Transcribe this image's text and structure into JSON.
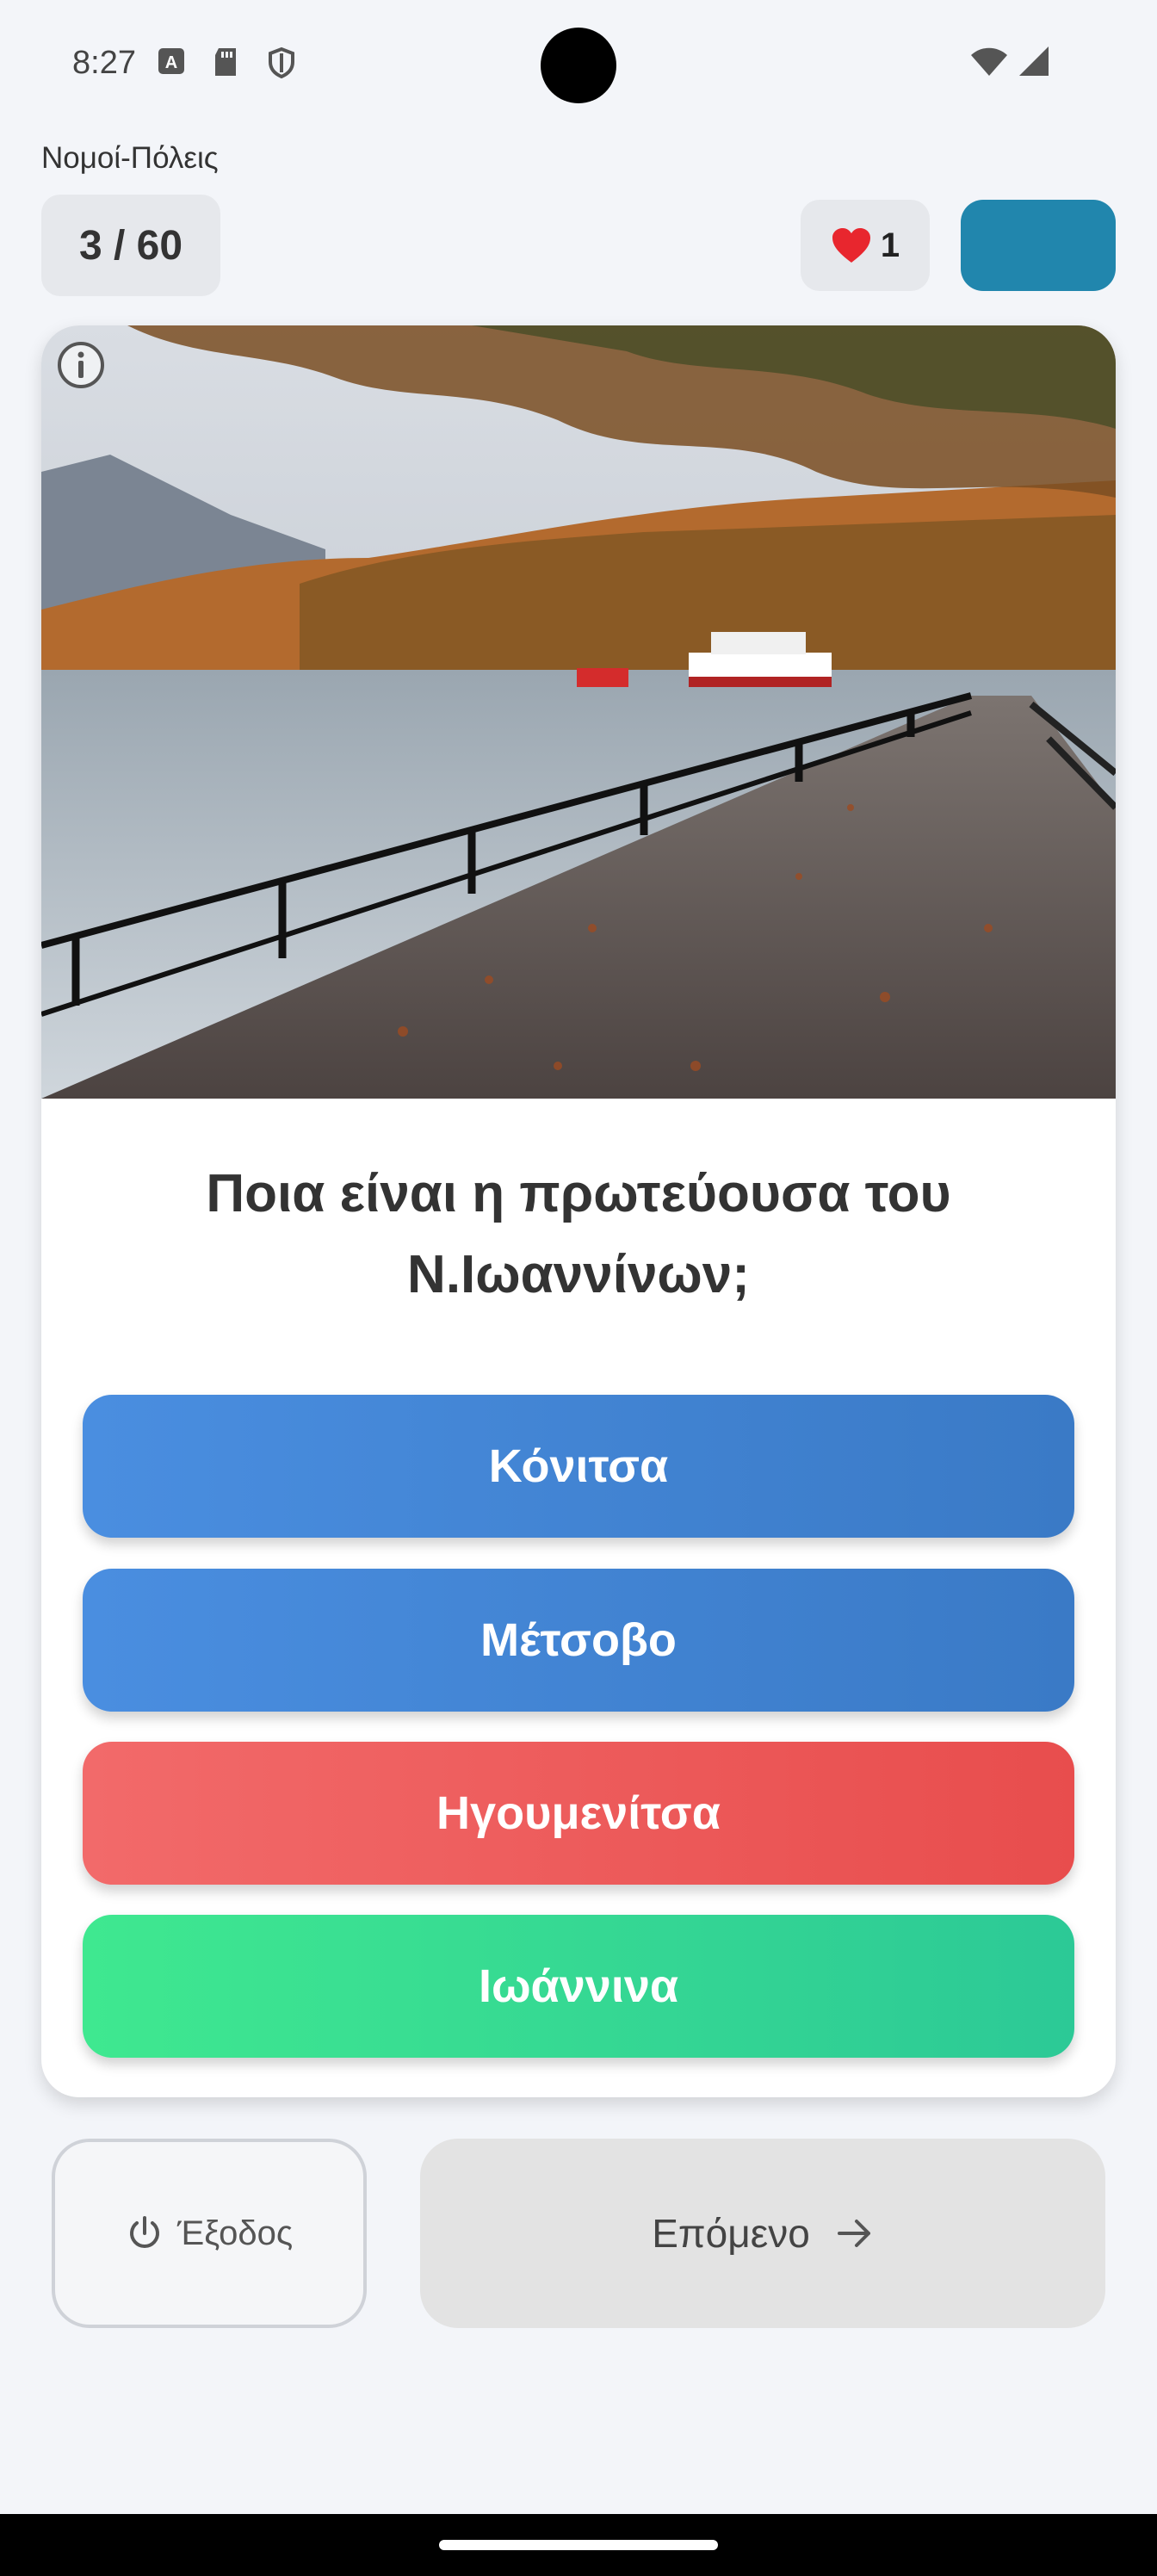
{
  "status_bar": {
    "time": "8:27",
    "icons": [
      "a-icon",
      "sd-card-icon",
      "shield-icon",
      "wifi-icon",
      "signal-icon"
    ]
  },
  "header": {
    "category": "Νομοί-Πόλεις",
    "progress": "3 / 60",
    "lives_icon": "heart-icon",
    "lives": "1"
  },
  "card": {
    "image_description": "lakeside-promenade-photo",
    "question": "Ποια είναι η πρωτεύουσα του\nΝ.Ιωαννίνων;",
    "answers": [
      {
        "label": "Κόνιτσα",
        "state": "neutral",
        "color": "#4a8ee0"
      },
      {
        "label": "Μέτσοβο",
        "state": "neutral",
        "color": "#4a8ee0"
      },
      {
        "label": "Ηγουμενίτσα",
        "state": "wrong",
        "color": "#f26a6a"
      },
      {
        "label": "Ιωάννινα",
        "state": "correct",
        "color": "#3fe890"
      }
    ]
  },
  "footer": {
    "exit_label": "Έξοδος",
    "next_label": "Επόμενο"
  },
  "colors": {
    "accent": "#2186ad",
    "background": "#f3f5f9"
  }
}
